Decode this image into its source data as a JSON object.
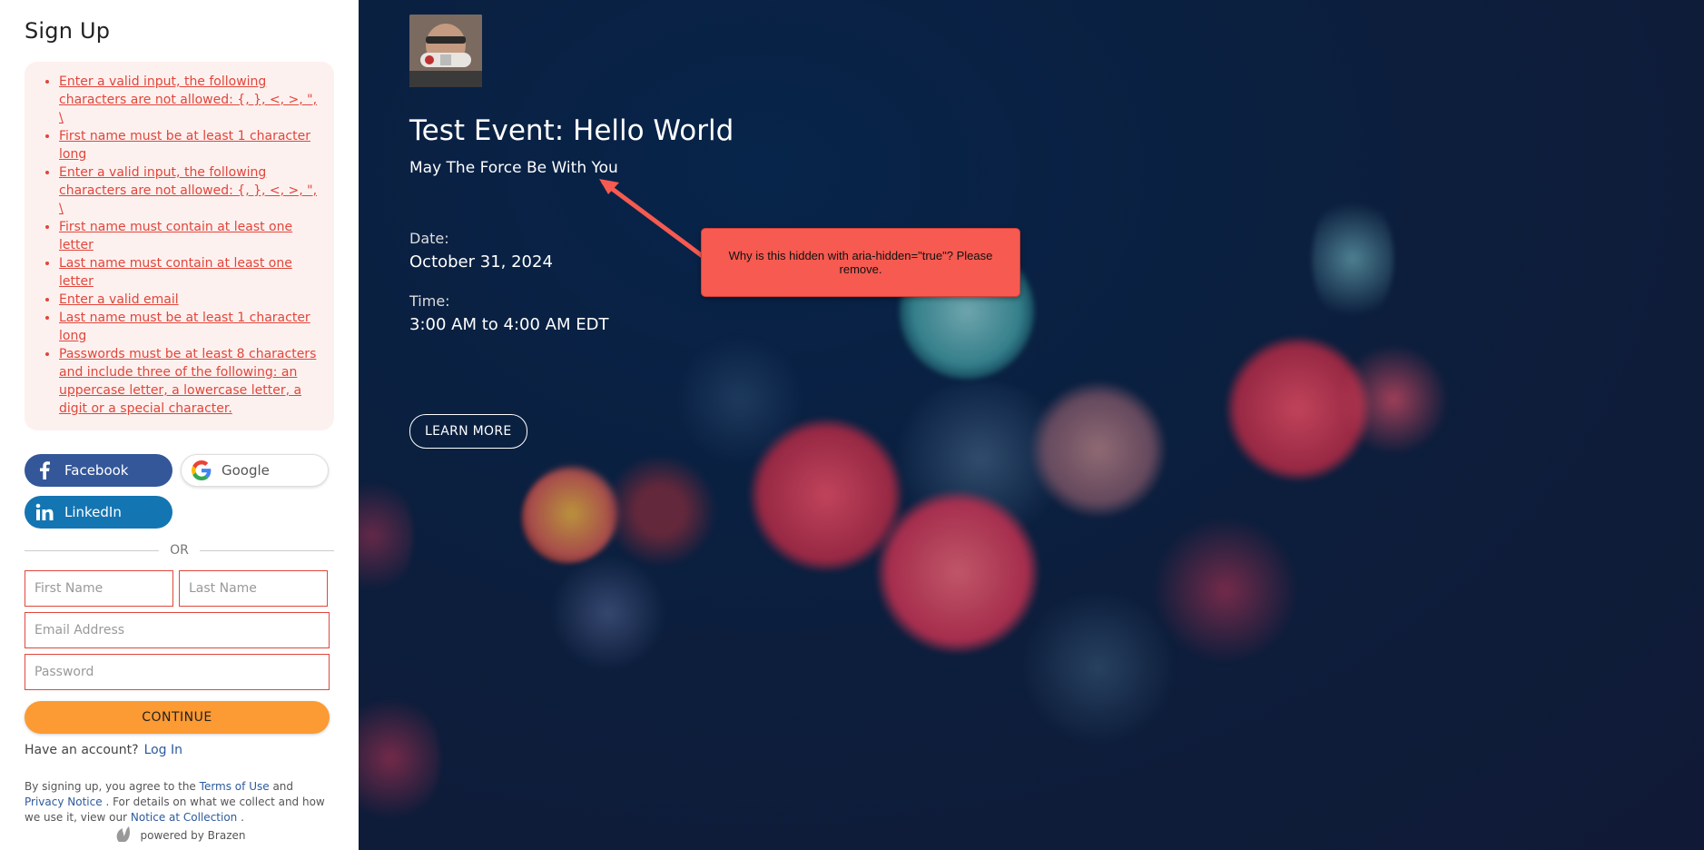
{
  "signup": {
    "title": "Sign Up",
    "errors": [
      "Enter a valid input, the following characters are not allowed: {, }, <, >, \", \\",
      "First name must be at least 1 character long",
      "Enter a valid input, the following characters are not allowed: {, }, <, >, \", \\",
      "First name must contain at least one letter",
      "Last name must contain at least one letter",
      "Enter a valid email",
      "Last name must be at least 1 character long",
      "Passwords must be at least 8 characters and include three of the following: an uppercase letter, a lowercase letter, a digit or a special character."
    ],
    "social": {
      "facebook": "Facebook",
      "google": "Google",
      "linkedin": "LinkedIn"
    },
    "or_label": "OR",
    "fields": {
      "first_name_placeholder": "First Name",
      "last_name_placeholder": "Last Name",
      "email_placeholder": "Email Address",
      "password_placeholder": "Password"
    },
    "continue_label": "CONTINUE",
    "have_account": "Have an account?",
    "login_label": "Log In",
    "legal": {
      "part1": "By signing up, you agree to the",
      "terms": "Terms of Use",
      "and": "and",
      "privacy": "Privacy Notice",
      "part2": ". For details on what we collect and how we use it, view our",
      "notice_collection": "Notice at Collection",
      "part3": "."
    },
    "powered_by": "powered by Brazen"
  },
  "event": {
    "title": "Test Event: Hello World",
    "subtitle": "May The Force Be With You",
    "date_label": "Date:",
    "date_value": "October 31, 2024",
    "time_label": "Time:",
    "time_value": "3:00 AM to 4:00 AM EDT",
    "learn_more": "LEARN MORE"
  },
  "annotation": {
    "text": "Why is this hidden with aria-hidden=\"true\"? Please remove.",
    "color": "#f65a50"
  },
  "colors": {
    "facebook": "#34579a",
    "linkedin": "#1475b3",
    "continue": "#fc9a33",
    "error": "#e0463b",
    "link": "#2c5a9e"
  }
}
